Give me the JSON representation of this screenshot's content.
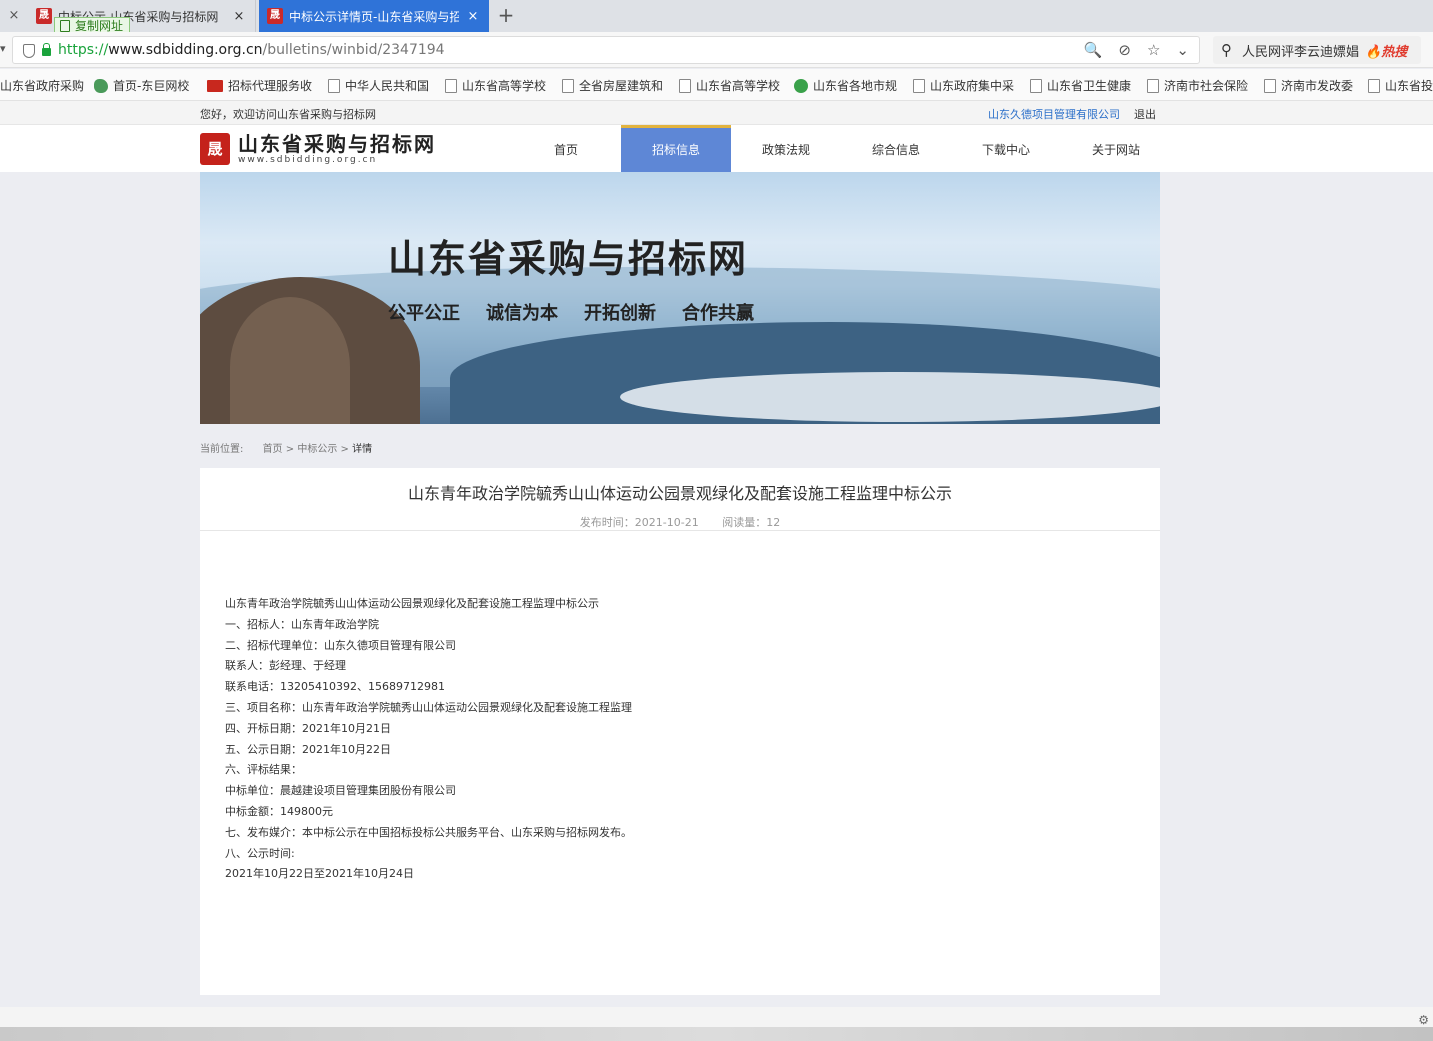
{
  "browser": {
    "tabs": [
      {
        "title": "中标公示-山东省采购与招标网",
        "favicon": "晟",
        "active": false
      },
      {
        "title": "中标公示详情页-山东省采购与招",
        "favicon": "晟",
        "active": true
      }
    ],
    "tab_close": "×",
    "new_tab": "+",
    "copy_tooltip": "复制网址",
    "url": {
      "scheme": "https://",
      "host": "www.sdbidding.org.cn",
      "path": "/bulletins/winbid/2347194"
    },
    "url_icons": [
      "🔍",
      "⊘",
      "☆",
      "⌄"
    ],
    "search": {
      "text": "人民网评李云迪嫖娼",
      "hot": "🔥热搜"
    },
    "bookmarks": [
      {
        "label": "山东省政府采购",
        "icon": "page"
      },
      {
        "label": "首页-东巨网校",
        "icon": "swirl"
      },
      {
        "label": "招标代理服务收",
        "icon": "red"
      },
      {
        "label": "中华人民共和国",
        "icon": "page"
      },
      {
        "label": "山东省高等学校",
        "icon": "page"
      },
      {
        "label": "全省房屋建筑和",
        "icon": "page"
      },
      {
        "label": "山东省高等学校",
        "icon": "page"
      },
      {
        "label": "山东省各地市规",
        "icon": "green"
      },
      {
        "label": "山东政府集中采",
        "icon": "page"
      },
      {
        "label": "山东省卫生健康",
        "icon": "page"
      },
      {
        "label": "济南市社会保险",
        "icon": "page"
      },
      {
        "label": "济南市发改委",
        "icon": "page"
      },
      {
        "label": "山东省投",
        "icon": "page"
      }
    ]
  },
  "site": {
    "welcome": "您好，欢迎访问山东省采购与招标网",
    "company": "山东久德项目管理有限公司",
    "logout": "退出",
    "logo": {
      "mark": "晟",
      "cn": "山东省采购与招标网",
      "en": "www.sdbidding.org.cn"
    },
    "nav": [
      {
        "label": "首页",
        "active": false
      },
      {
        "label": "招标信息",
        "active": true
      },
      {
        "label": "政策法规",
        "active": false
      },
      {
        "label": "综合信息",
        "active": false
      },
      {
        "label": "下载中心",
        "active": false
      },
      {
        "label": "关于网站",
        "active": false
      }
    ],
    "banner": {
      "title": "山东省采购与招标网",
      "slogans": [
        "公平公正",
        "诚信为本",
        "开拓创新",
        "合作共赢"
      ]
    },
    "breadcrumb": {
      "label": "当前位置:",
      "items": [
        "首页",
        "中标公示",
        "详情"
      ],
      "separator": ">"
    }
  },
  "article": {
    "title": "山东青年政治学院毓秀山山体运动公园景观绿化及配套设施工程监理中标公示",
    "publish_time": "发布时间：2021-10-21",
    "views": "阅读量：12",
    "lines": [
      "山东青年政治学院毓秀山山体运动公园景观绿化及配套设施工程监理中标公示",
      "一、招标人：山东青年政治学院",
      "二、招标代理单位：山东久德项目管理有限公司",
      "联系人：彭经理、于经理",
      "联系电话：13205410392、15689712981",
      "三、项目名称：山东青年政治学院毓秀山山体运动公园景观绿化及配套设施工程监理",
      "四、开标日期：2021年10月21日",
      "五、公示日期：2021年10月22日",
      "六、评标结果：",
      "中标单位：晨越建设项目管理集团股份有限公司",
      "中标金额：149800元",
      "七、发布媒介：本中标公示在中国招标投标公共服务平台、山东采购与招标网发布。",
      "八、公示时间:",
      "2021年10月22日至2021年10月24日"
    ]
  },
  "colors": {
    "accent_blue": "#2f73d8",
    "nav_active": "#5e87d6",
    "nav_active_top": "#e2b33e",
    "logo_red": "#c4221b",
    "link_blue": "#2b6fc9"
  }
}
